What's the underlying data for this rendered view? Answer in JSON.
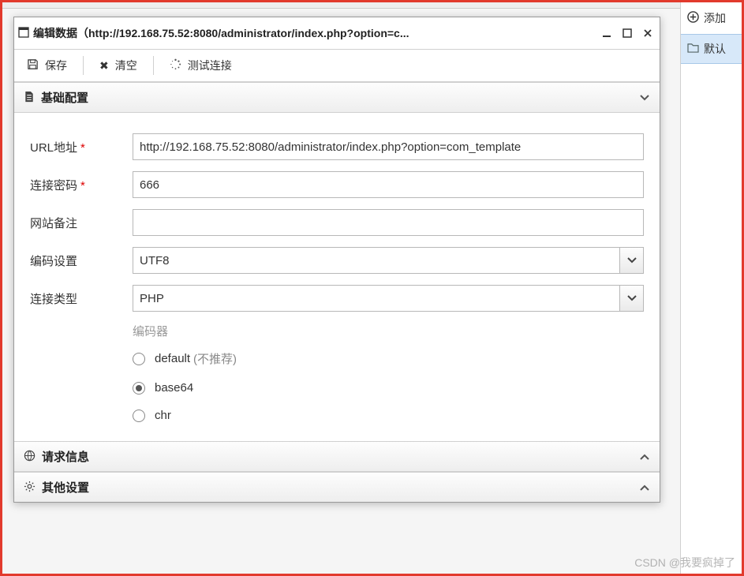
{
  "window": {
    "title": "编辑数据（http://192.168.75.52:8080/administrator/index.php?option=c..."
  },
  "toolbar": {
    "save_label": "保存",
    "clear_label": "清空",
    "test_label": "测试连接"
  },
  "sidebar": {
    "add_label": "添加",
    "default_folder": "默认"
  },
  "panels": {
    "basic": {
      "title": "基础配置"
    },
    "request": {
      "title": "请求信息"
    },
    "other": {
      "title": "其他设置"
    }
  },
  "form": {
    "url_label": "URL地址",
    "url_value": "http://192.168.75.52:8080/administrator/index.php?option=com_template",
    "password_label": "连接密码",
    "password_value": "666",
    "remark_label": "网站备注",
    "remark_value": "",
    "encoding_label": "编码设置",
    "encoding_value": "UTF8",
    "conntype_label": "连接类型",
    "conntype_value": "PHP",
    "encoder_group_label": "编码器",
    "encoder_options": {
      "default": {
        "label": "default",
        "note": "(不推荐)"
      },
      "base64": {
        "label": "base64"
      },
      "chr": {
        "label": "chr"
      }
    },
    "encoder_selected": "base64"
  },
  "watermark": "CSDN @我要疯掉了"
}
